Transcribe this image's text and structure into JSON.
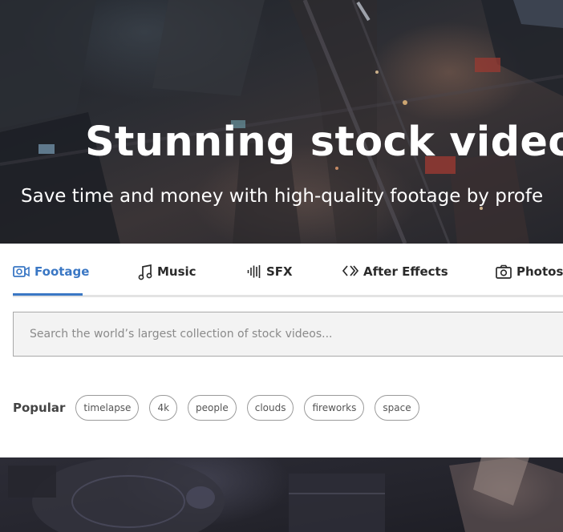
{
  "hero": {
    "title": "Stunning stock video, c",
    "subtitle": "Save time and money with high-quality footage by profe"
  },
  "tabs": [
    {
      "label": "Footage",
      "icon": "video-camera-icon",
      "active": true
    },
    {
      "label": "Music",
      "icon": "music-note-icon",
      "active": false
    },
    {
      "label": "SFX",
      "icon": "waveform-icon",
      "active": false
    },
    {
      "label": "After Effects",
      "icon": "after-effects-icon",
      "active": false
    },
    {
      "label": "Photos",
      "icon": "camera-icon",
      "active": false
    }
  ],
  "search": {
    "placeholder": "Search the world’s largest collection of stock videos..."
  },
  "popular": {
    "label": "Popular",
    "tags": [
      "timelapse",
      "4k",
      "people",
      "clouds",
      "fireworks",
      "space"
    ]
  },
  "colors": {
    "accent": "#3a77c4",
    "hero_text": "#ffffff",
    "tab_underline": "#e3e3e3"
  }
}
